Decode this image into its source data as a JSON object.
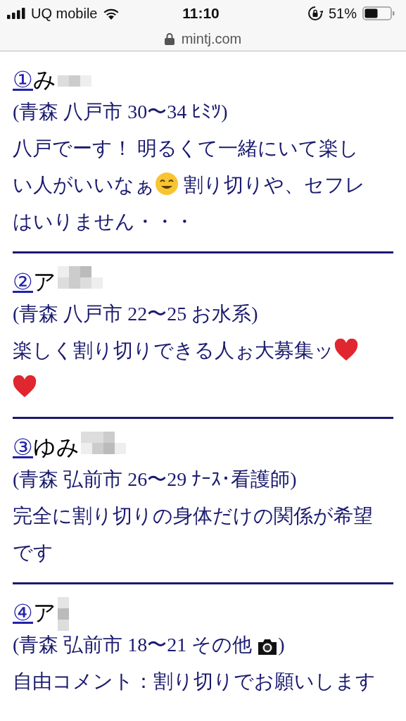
{
  "status_bar": {
    "carrier": "UQ mobile",
    "time": "11:10",
    "battery": "51%"
  },
  "address_bar": {
    "url": "mintj.com"
  },
  "entries": [
    {
      "number": "①",
      "name": "み",
      "info": [
        {
          "kind": "text",
          "text": "(青森 八戸市 30〜34 ﾋﾐﾂ)"
        }
      ],
      "comment": [
        [
          {
            "kind": "text",
            "text": "八戸でーす！ 明るくて一緒にいて楽し"
          }
        ],
        [
          {
            "kind": "text",
            "text": "い人がいいなぁ"
          },
          {
            "kind": "smiley"
          },
          {
            "kind": "text",
            "text": " 割り切りや、セフレ"
          }
        ],
        [
          {
            "kind": "text",
            "text": "はいりません・・・"
          }
        ]
      ]
    },
    {
      "number": "②",
      "name": "ア",
      "info": [
        {
          "kind": "text",
          "text": "(青森 八戸市 22〜25 お水系)"
        }
      ],
      "comment": [
        [
          {
            "kind": "text",
            "text": "楽しく割り切りできる人ぉ大募集ッ"
          },
          {
            "kind": "heart"
          }
        ],
        [
          {
            "kind": "heart"
          }
        ]
      ]
    },
    {
      "number": "③",
      "name": "ゆみ",
      "info": [
        {
          "kind": "text",
          "text": "(青森 弘前市 26〜29 ﾅｰｽ･看護師)"
        }
      ],
      "comment": [
        [
          {
            "kind": "text",
            "text": "完全に割り切りの身体だけの関係が希望"
          }
        ],
        [
          {
            "kind": "text",
            "text": "です"
          }
        ]
      ]
    },
    {
      "number": "④",
      "name": "ア",
      "info": [
        {
          "kind": "text",
          "text": "(青森 弘前市 18〜21 その他 "
        },
        {
          "kind": "camera"
        },
        {
          "kind": "text",
          "text": ")"
        }
      ],
      "comment": [
        [
          {
            "kind": "text",
            "text": "自由コメント：割り切りでお願いします"
          }
        ]
      ]
    }
  ]
}
